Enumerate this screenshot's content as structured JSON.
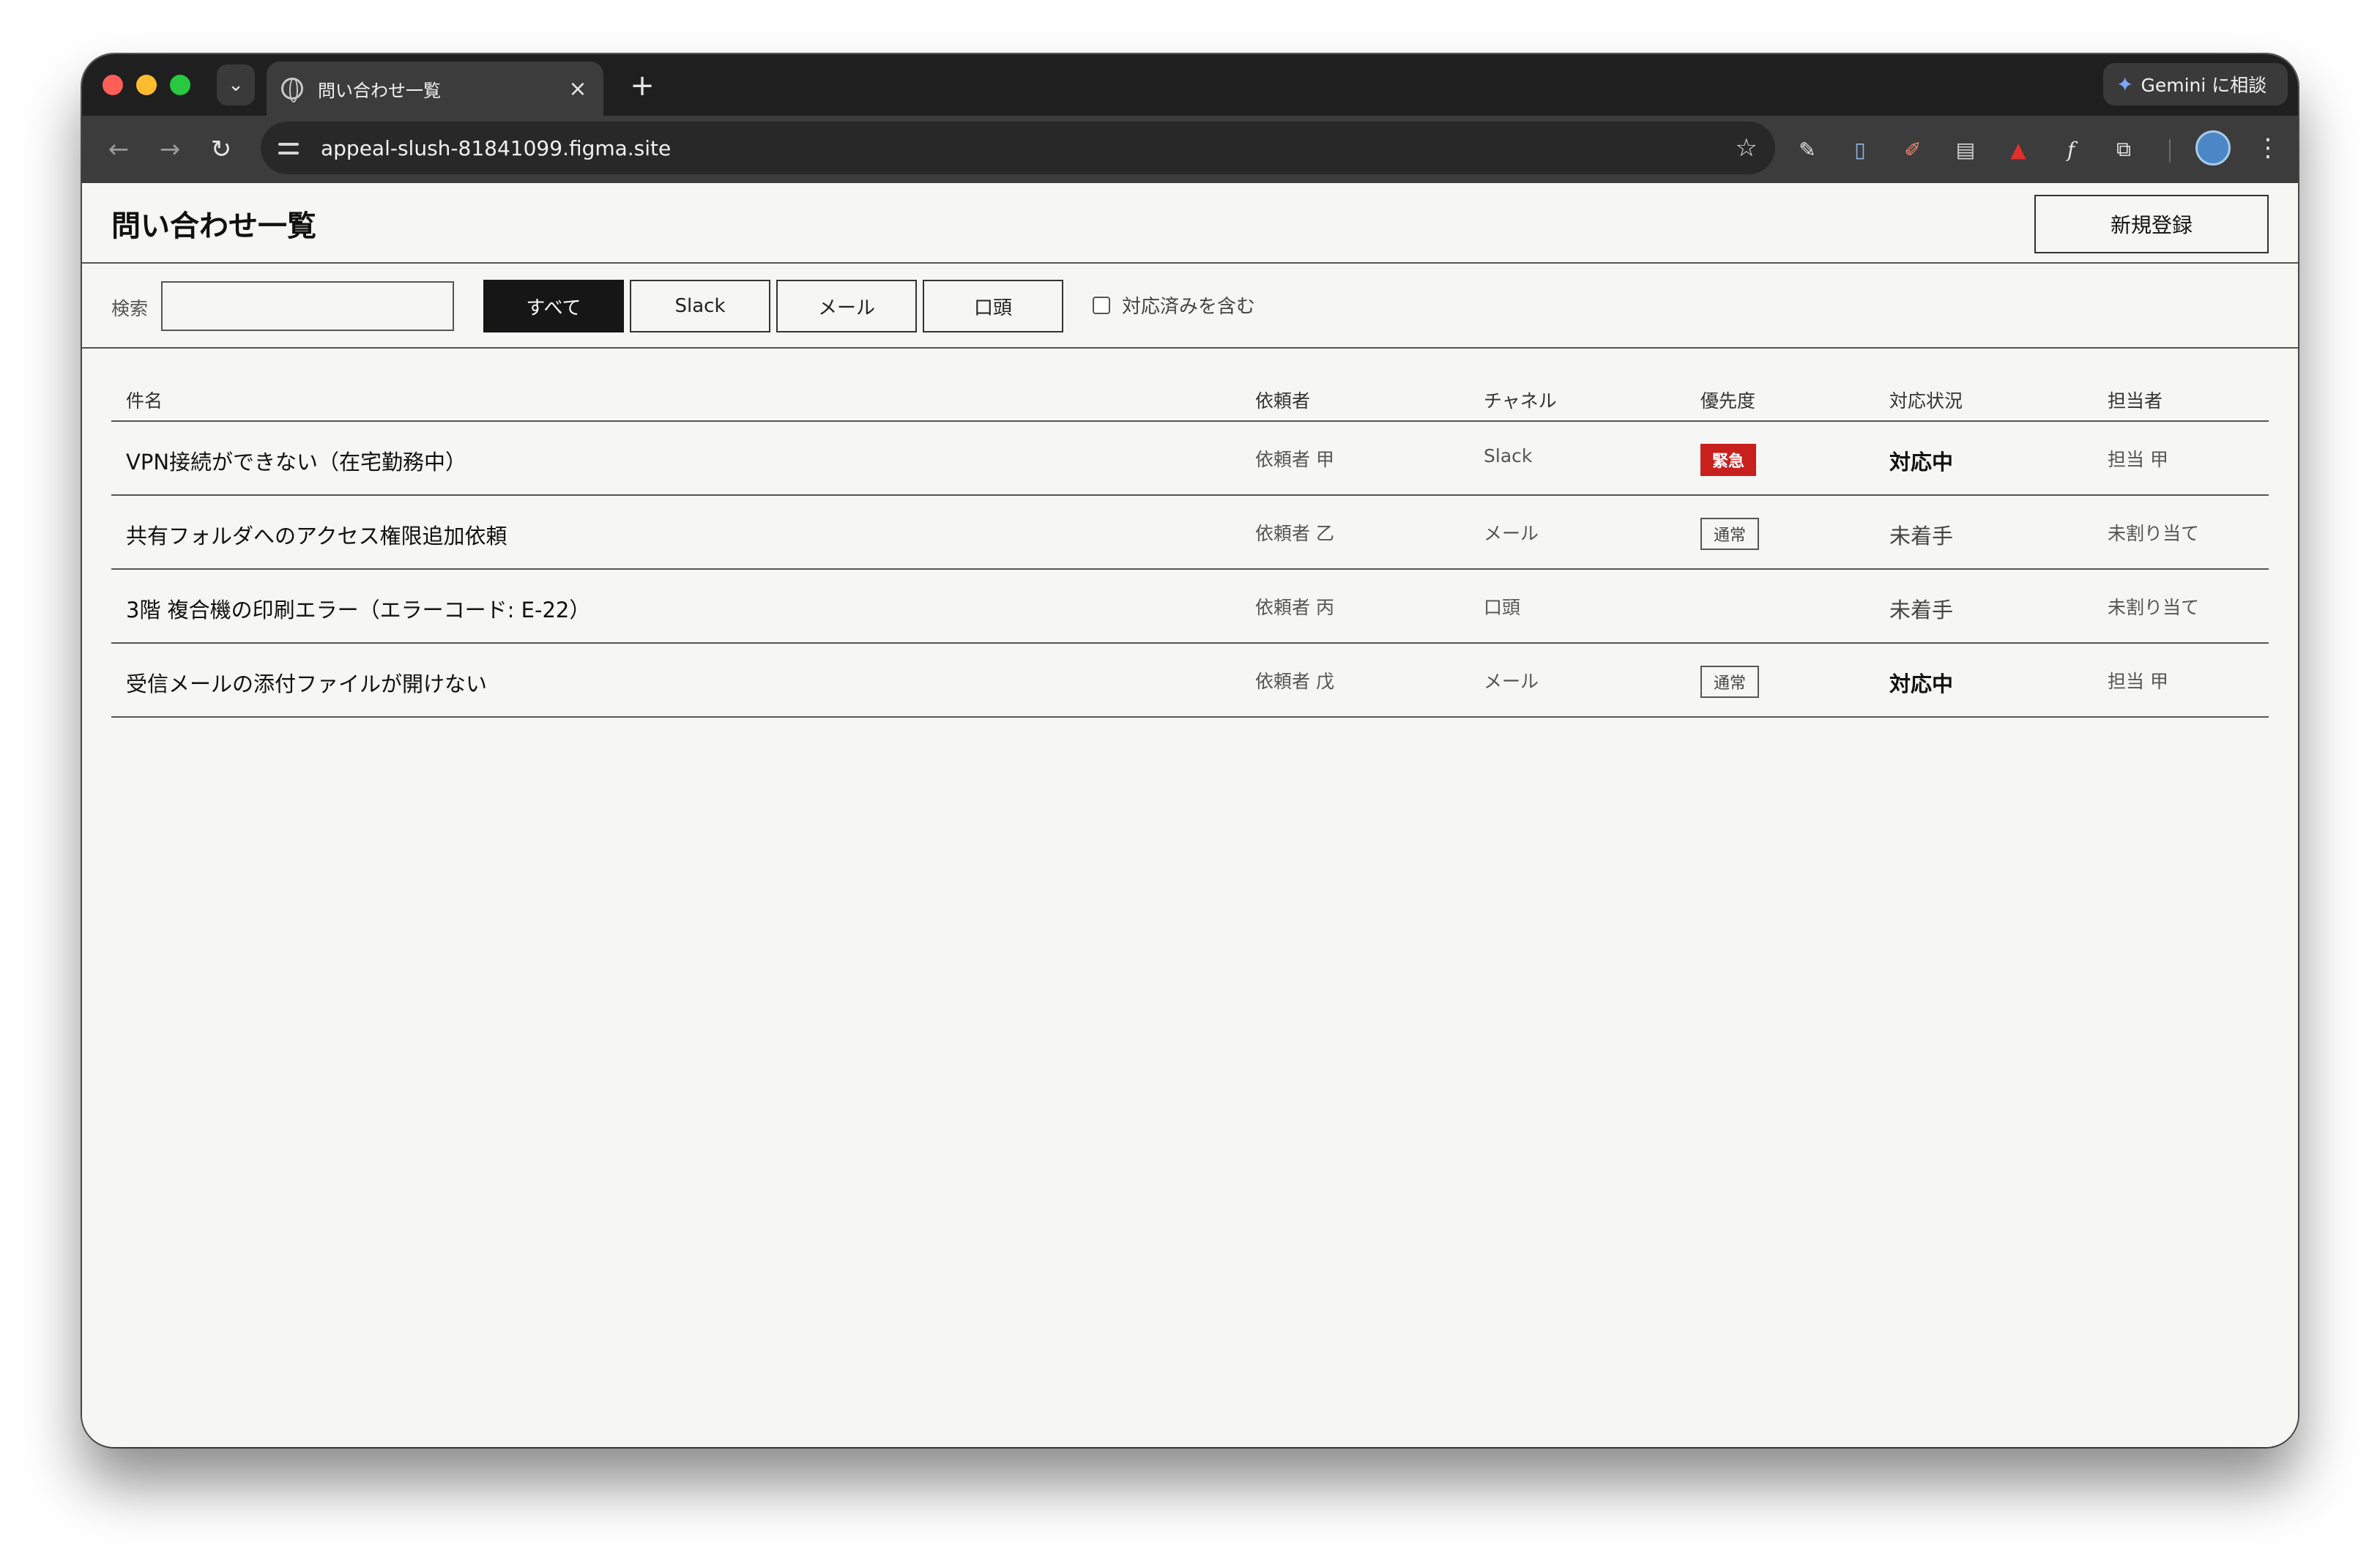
{
  "browser": {
    "tab_title": "問い合わせ一覧",
    "tab_close": "×",
    "new_tab": "+",
    "url": "appeal-slush-81841099.figma.site",
    "gemini_label": "Gemini に相談",
    "icons": [
      "back-arrow-icon",
      "forward-arrow-icon",
      "reload-icon",
      "site-settings-icon",
      "star-icon",
      "eyedropper-icon",
      "phone-extension-icon",
      "pen-extension-icon",
      "printer-extension-icon",
      "pdf-extension-icon",
      "formula-extension-icon",
      "puzzle-extension-icon",
      "profile-avatar",
      "kebab-menu-icon"
    ]
  },
  "header": {
    "title": "問い合わせ一覧",
    "new_button": "新規登録"
  },
  "filters": {
    "search_label": "検索",
    "search_value": "",
    "channels": [
      "すべて",
      "Slack",
      "メール",
      "口頭"
    ],
    "active_channel": "すべて",
    "include_done_label": "対応済みを含む",
    "include_done_checked": false
  },
  "table": {
    "columns": [
      "件名",
      "依頼者",
      "チャネル",
      "優先度",
      "対応状況",
      "担当者"
    ],
    "rows": [
      {
        "subject": "VPN接続ができない（在宅勤務中）",
        "requester": "依頼者 甲",
        "channel": "Slack",
        "priority": "緊急",
        "priority_style": "urgent",
        "status": "対応中",
        "status_bold": true,
        "assignee": "担当 甲"
      },
      {
        "subject": "共有フォルダへのアクセス権限追加依頼",
        "requester": "依頼者 乙",
        "channel": "メール",
        "priority": "通常",
        "priority_style": "normal",
        "status": "未着手",
        "status_bold": false,
        "assignee": "未割り当て"
      },
      {
        "subject": "3階 複合機の印刷エラー（エラーコード: E-22）",
        "requester": "依頼者 丙",
        "channel": "口頭",
        "priority": "",
        "priority_style": "none",
        "status": "未着手",
        "status_bold": false,
        "assignee": "未割り当て"
      },
      {
        "subject": "受信メールの添付ファイルが開けない",
        "requester": "依頼者 戊",
        "channel": "メール",
        "priority": "通常",
        "priority_style": "normal",
        "status": "対応中",
        "status_bold": true,
        "assignee": "担当 甲"
      }
    ]
  },
  "colors": {
    "accent_dark": "#161616",
    "urgent": "#c8201d",
    "page_bg": "#f6f6f4"
  }
}
